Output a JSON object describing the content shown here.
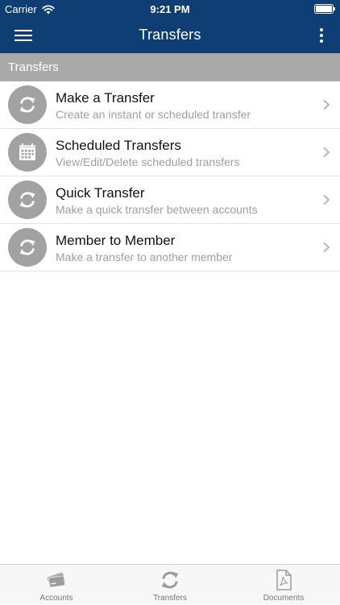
{
  "status_bar": {
    "carrier": "Carrier",
    "time": "9:21 PM",
    "battery_level": 1.0,
    "wifi_icon": "wifi-icon",
    "battery_icon": "battery-icon"
  },
  "navbar": {
    "title": "Transfers",
    "menu_icon": "hamburger-menu-icon",
    "more_icon": "vertical-ellipsis-icon",
    "background_color": "#0e3e73"
  },
  "section": {
    "header": "Transfers",
    "background_color": "#a9a9a9"
  },
  "items": [
    {
      "title": "Make a Transfer",
      "subtitle": "Create an instant or scheduled transfer",
      "icon": "transfer-arrows-icon"
    },
    {
      "title": "Scheduled Transfers",
      "subtitle": "View/Edit/Delete scheduled transfers",
      "icon": "calendar-icon"
    },
    {
      "title": "Quick Transfer",
      "subtitle": "Make a quick transfer between accounts",
      "icon": "transfer-arrows-icon"
    },
    {
      "title": "Member to Member",
      "subtitle": "Make a transfer to another member",
      "icon": "transfer-arrows-icon"
    }
  ],
  "tabs": [
    {
      "label": "Accounts",
      "icon": "cards-icon"
    },
    {
      "label": "Transfers",
      "icon": "transfer-arrows-icon"
    },
    {
      "label": "Documents",
      "icon": "pdf-document-icon"
    }
  ]
}
